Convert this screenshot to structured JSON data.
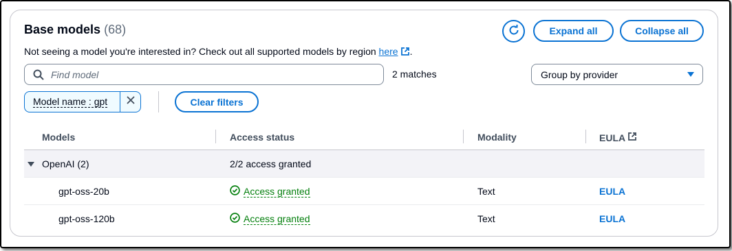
{
  "header": {
    "title": "Base models",
    "count": "(68)",
    "subtitle_text": "Not seeing a model you're interested in? Check out all supported models by region",
    "subtitle_link": "here",
    "subtitle_end": ".",
    "expand_all": "Expand all",
    "collapse_all": "Collapse all"
  },
  "search": {
    "placeholder": "Find model",
    "matches": "2 matches"
  },
  "group_select": {
    "value": "Group by provider"
  },
  "filter_token": {
    "label": "Model name : gpt"
  },
  "clear_filters": "Clear filters",
  "table": {
    "columns": [
      "Models",
      "Access status",
      "Modality",
      "EULA"
    ],
    "group": {
      "name": "OpenAI (2)",
      "access": "2/2 access granted"
    },
    "rows": [
      {
        "model": "gpt-oss-20b",
        "status": "Access granted",
        "modality": "Text",
        "eula": "EULA"
      },
      {
        "model": "gpt-oss-120b",
        "status": "Access granted",
        "modality": "Text",
        "eula": "EULA"
      }
    ]
  },
  "colors": {
    "accent": "#0972d3",
    "success": "#037f0c",
    "text": "#000716"
  }
}
